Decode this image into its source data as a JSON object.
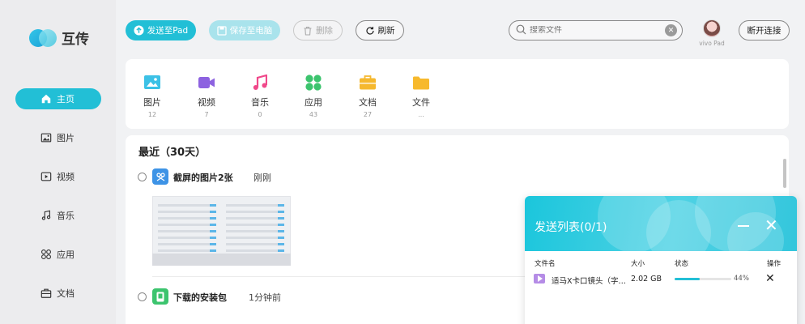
{
  "app": {
    "logo_text": "互传"
  },
  "sidebar": {
    "items": [
      {
        "label": "主页",
        "icon": "home-icon",
        "active": true
      },
      {
        "label": "图片",
        "icon": "image-icon",
        "active": false
      },
      {
        "label": "视频",
        "icon": "video-icon",
        "active": false
      },
      {
        "label": "音乐",
        "icon": "music-icon",
        "active": false
      },
      {
        "label": "应用",
        "icon": "apps-icon",
        "active": false
      },
      {
        "label": "文档",
        "icon": "document-icon",
        "active": false
      }
    ]
  },
  "toolbar": {
    "send_label": "发送至Pad",
    "save_label": "保存至电脑",
    "delete_label": "删除",
    "refresh_label": "刷新",
    "search_placeholder": "搜索文件",
    "device_name": "vivo Pad",
    "disconnect_label": "断开连接"
  },
  "categories": [
    {
      "label": "图片",
      "count": "12",
      "icon": "image-icon",
      "color": "#3cc1e6"
    },
    {
      "label": "视频",
      "count": "7",
      "icon": "video-icon",
      "color": "#8d62e0"
    },
    {
      "label": "音乐",
      "count": "0",
      "icon": "music-icon",
      "color": "#f0488a"
    },
    {
      "label": "应用",
      "count": "43",
      "icon": "apps-icon",
      "color": "#3cc46e"
    },
    {
      "label": "文档",
      "count": "27",
      "icon": "briefcase-icon",
      "color": "#f5b82e"
    },
    {
      "label": "文件",
      "count": "...",
      "icon": "folder-icon",
      "color": "#f7b92c"
    }
  ],
  "recent": {
    "title": "最近（30天）",
    "groups": [
      {
        "name": "截屏的图片2张",
        "time": "刚刚",
        "icon": "screenshot-icon",
        "color": "#3d93e6"
      },
      {
        "name": "下载的安装包",
        "time": "1分钟前",
        "icon": "package-icon",
        "color": "#3cc46e"
      }
    ]
  },
  "send_list": {
    "title": "发送列表(0/1)",
    "columns": [
      "文件名",
      "大小",
      "状态",
      "操作"
    ],
    "rows": [
      {
        "file_name": "适马X卡口镜头（字…",
        "size": "2.02 GB",
        "progress": 0.44,
        "progress_label": "44%",
        "icon": "video-file-icon"
      }
    ]
  }
}
